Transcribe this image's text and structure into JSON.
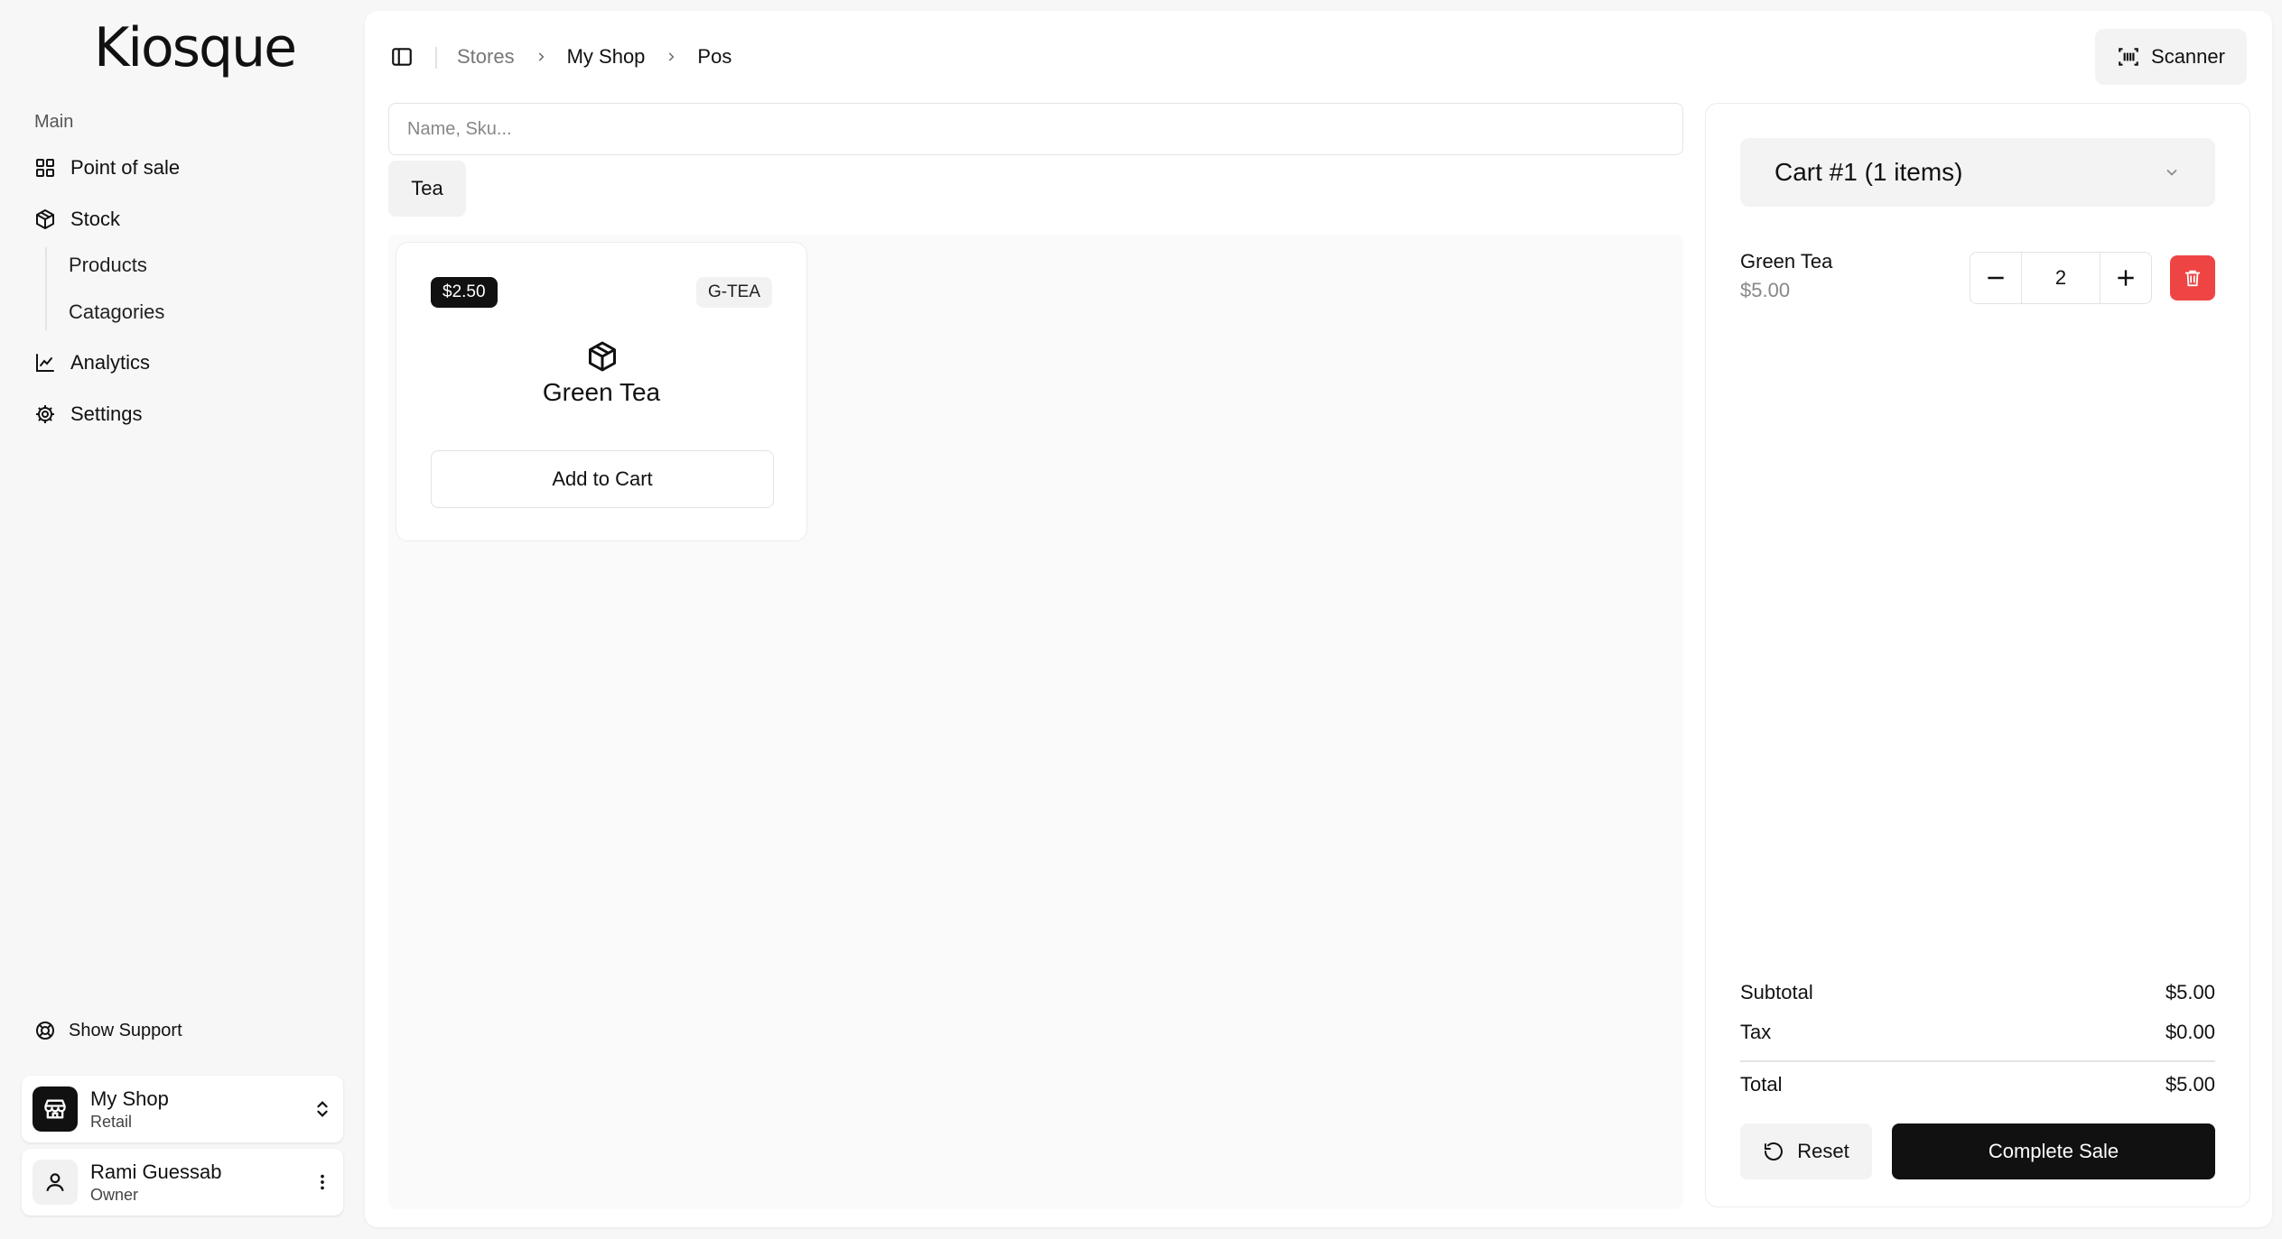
{
  "app": {
    "logo": "Kiosque"
  },
  "sidebar": {
    "section_label": "Main",
    "items": [
      {
        "label": "Point of sale",
        "icon": "grid-icon"
      },
      {
        "label": "Stock",
        "icon": "box-icon"
      },
      {
        "label": "Analytics",
        "icon": "chart-icon"
      },
      {
        "label": "Settings",
        "icon": "gear-icon"
      }
    ],
    "stock_sub": [
      {
        "label": "Products"
      },
      {
        "label": "Catagories"
      }
    ],
    "support_label": "Show Support",
    "shop": {
      "name": "My Shop",
      "type": "Retail"
    },
    "user": {
      "name": "Rami Guessab",
      "role": "Owner"
    }
  },
  "header": {
    "breadcrumb": [
      "Stores",
      "My Shop",
      "Pos"
    ],
    "scanner_label": "Scanner"
  },
  "search": {
    "placeholder": "Name, Sku..."
  },
  "category_chip": "Tea",
  "products": [
    {
      "price": "$2.50",
      "sku": "G-TEA",
      "name": "Green Tea",
      "add_label": "Add to Cart"
    }
  ],
  "cart": {
    "title": "Cart #1 (1 items)",
    "lines": [
      {
        "name": "Green Tea",
        "price": "$5.00",
        "qty": "2"
      }
    ],
    "subtotal_label": "Subtotal",
    "subtotal": "$5.00",
    "tax_label": "Tax",
    "tax": "$0.00",
    "total_label": "Total",
    "total": "$5.00",
    "reset_label": "Reset",
    "complete_label": "Complete Sale"
  },
  "colors": {
    "accent": "#111111",
    "danger": "#ef4444",
    "background": "#f7f7f7"
  }
}
